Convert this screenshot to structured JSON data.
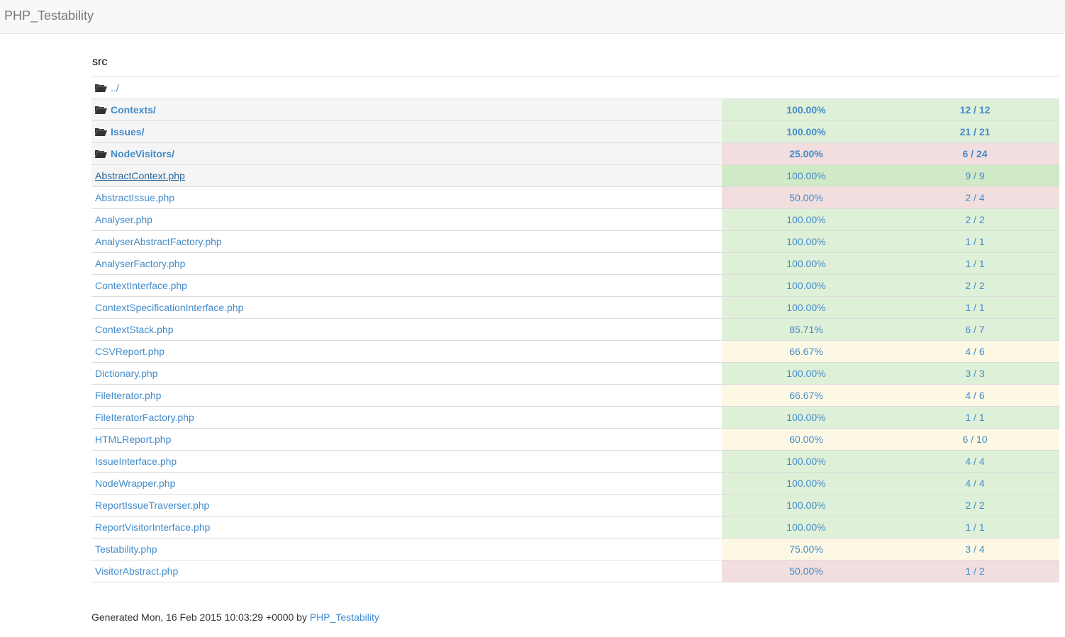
{
  "navbar": {
    "brand": "PHP_Testability"
  },
  "breadcrumb": "src",
  "parent_link": "../",
  "rows": [
    {
      "name": "Contexts/",
      "type": "dir",
      "pct": "100.00%",
      "count": "12 / 12",
      "status": "success"
    },
    {
      "name": "Issues/",
      "type": "dir",
      "pct": "100.00%",
      "count": "21 / 21",
      "status": "success"
    },
    {
      "name": "NodeVisitors/",
      "type": "dir",
      "pct": "25.00%",
      "count": "6 / 24",
      "status": "danger"
    },
    {
      "name": "AbstractContext.php",
      "type": "file",
      "pct": "100.00%",
      "count": "9 / 9",
      "status": "success",
      "hover": true
    },
    {
      "name": "AbstractIssue.php",
      "type": "file",
      "pct": "50.00%",
      "count": "2 / 4",
      "status": "danger"
    },
    {
      "name": "Analyser.php",
      "type": "file",
      "pct": "100.00%",
      "count": "2 / 2",
      "status": "success"
    },
    {
      "name": "AnalyserAbstractFactory.php",
      "type": "file",
      "pct": "100.00%",
      "count": "1 / 1",
      "status": "success"
    },
    {
      "name": "AnalyserFactory.php",
      "type": "file",
      "pct": "100.00%",
      "count": "1 / 1",
      "status": "success"
    },
    {
      "name": "ContextInterface.php",
      "type": "file",
      "pct": "100.00%",
      "count": "2 / 2",
      "status": "success"
    },
    {
      "name": "ContextSpecificationInterface.php",
      "type": "file",
      "pct": "100.00%",
      "count": "1 / 1",
      "status": "success"
    },
    {
      "name": "ContextStack.php",
      "type": "file",
      "pct": "85.71%",
      "count": "6 / 7",
      "status": "success"
    },
    {
      "name": "CSVReport.php",
      "type": "file",
      "pct": "66.67%",
      "count": "4 / 6",
      "status": "warning"
    },
    {
      "name": "Dictionary.php",
      "type": "file",
      "pct": "100.00%",
      "count": "3 / 3",
      "status": "success"
    },
    {
      "name": "FileIterator.php",
      "type": "file",
      "pct": "66.67%",
      "count": "4 / 6",
      "status": "warning"
    },
    {
      "name": "FileIteratorFactory.php",
      "type": "file",
      "pct": "100.00%",
      "count": "1 / 1",
      "status": "success"
    },
    {
      "name": "HTMLReport.php",
      "type": "file",
      "pct": "60.00%",
      "count": "6 / 10",
      "status": "warning"
    },
    {
      "name": "IssueInterface.php",
      "type": "file",
      "pct": "100.00%",
      "count": "4 / 4",
      "status": "success"
    },
    {
      "name": "NodeWrapper.php",
      "type": "file",
      "pct": "100.00%",
      "count": "4 / 4",
      "status": "success"
    },
    {
      "name": "ReportIssueTraverser.php",
      "type": "file",
      "pct": "100.00%",
      "count": "2 / 2",
      "status": "success"
    },
    {
      "name": "ReportVisitorInterface.php",
      "type": "file",
      "pct": "100.00%",
      "count": "1 / 1",
      "status": "success"
    },
    {
      "name": "Testability.php",
      "type": "file",
      "pct": "75.00%",
      "count": "3 / 4",
      "status": "warning"
    },
    {
      "name": "VisitorAbstract.php",
      "type": "file",
      "pct": "50.00%",
      "count": "1 / 2",
      "status": "danger"
    }
  ],
  "footer": {
    "text": "Generated Mon, 16 Feb 2015 10:03:29 +0000 by ",
    "link": "PHP_Testability"
  },
  "colors": {
    "success": "#dff0d8",
    "danger": "#f2dede",
    "warning": "#fcf8e3",
    "link": "#428bca"
  }
}
